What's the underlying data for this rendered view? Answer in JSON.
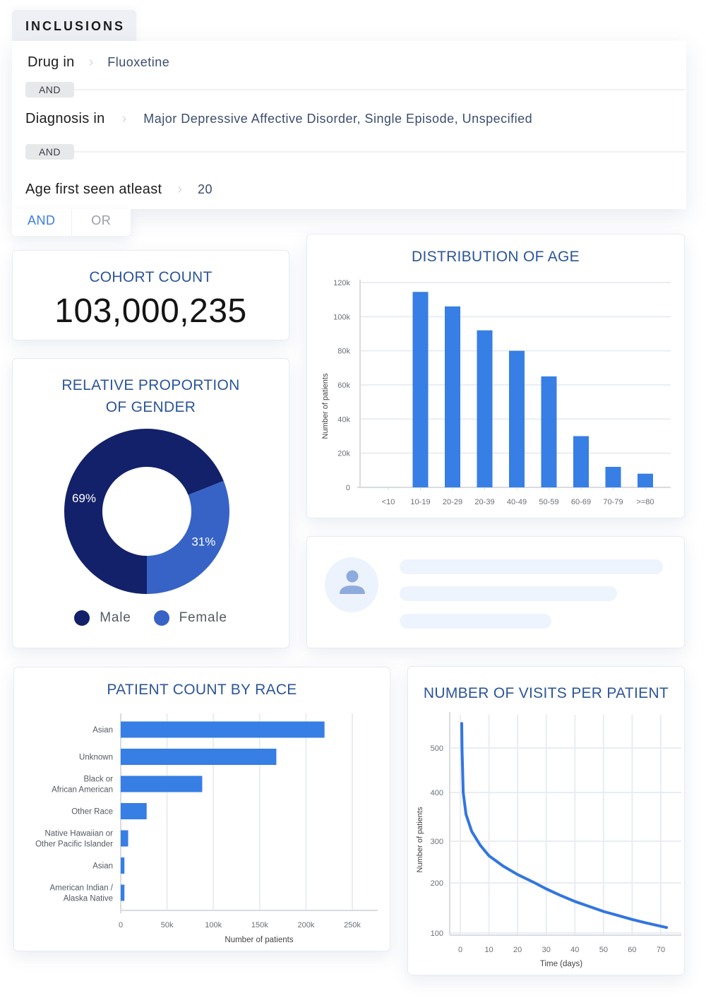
{
  "inclusions": {
    "tab_label": "INCLUSIONS",
    "rules": [
      {
        "label": "Drug in",
        "chevron_icon": "chevron-right-icon",
        "value": "Fluoxetine"
      },
      {
        "label": "Diagnosis in",
        "chevron_icon": "chevron-right-icon",
        "value": "Major Depressive Affective Disorder, Single Episode, Unspecified"
      },
      {
        "label": "Age first seen atleast",
        "chevron_icon": "chevron-right-icon",
        "value": "20"
      }
    ],
    "separators": [
      "AND",
      "AND"
    ],
    "logic_toggle": {
      "options": [
        "AND",
        "OR"
      ],
      "selected": "AND"
    }
  },
  "cohort": {
    "title": "COHORT COUNT",
    "value": "103,000,235"
  },
  "gender": {
    "title_line1": "RELATIVE PROPORTION",
    "title_line2": "OF GENDER"
  },
  "placeholder_card": {
    "avatar_icon": "user-icon",
    "skeleton_lines": 3
  },
  "colors": {
    "title_blue": "#2c5597",
    "bar_blue": "#377ee5",
    "male_navy": "#13216a",
    "female_blue": "#3663c5",
    "and_active": "#3b7ddd"
  },
  "chart_data": [
    {
      "id": "age",
      "type": "bar",
      "title": "DISTRIBUTION OF AGE",
      "xlabel": "",
      "ylabel": "Number of patients",
      "categories": [
        "<10",
        "10-19",
        "20-29",
        "20-39",
        "40-49",
        "50-59",
        "60-69",
        "70-79",
        ">=80"
      ],
      "values": [
        0,
        114500,
        106000,
        92000,
        80000,
        65000,
        30000,
        12000,
        8000
      ],
      "yticks": [
        0,
        20000,
        40000,
        60000,
        80000,
        100000,
        120000
      ],
      "ytick_labels": [
        "0",
        "20k",
        "40k",
        "60k",
        "80k",
        "100k",
        "120k"
      ],
      "ylim": [
        0,
        120000
      ],
      "grid": true
    },
    {
      "id": "gender",
      "type": "pie",
      "title": "RELATIVE PROPORTION OF GENDER",
      "labels": [
        "Male",
        "Female"
      ],
      "values": [
        69,
        31
      ],
      "value_labels": [
        "69%",
        "31%"
      ],
      "donut": true,
      "legend": "bottom"
    },
    {
      "id": "race",
      "type": "bar",
      "orientation": "horizontal",
      "title": "PATIENT COUNT BY RACE",
      "xlabel": "Number of patients",
      "ylabel": "",
      "categories": [
        "Asian",
        "Unknown",
        "Black or\nAfrican American",
        "Other Race",
        "Native Hawaiian or\nOther Pacific Islander",
        "Asian",
        "American Indian /\nAlaska Native"
      ],
      "values": [
        220000,
        168000,
        88000,
        28000,
        8000,
        4000,
        4000
      ],
      "xticks": [
        0,
        50000,
        100000,
        150000,
        200000,
        250000
      ],
      "xtick_labels": [
        "0",
        "50k",
        "100k",
        "150k",
        "200k",
        "250k"
      ],
      "xlim": [
        0,
        275000
      ],
      "grid": true
    },
    {
      "id": "visits",
      "type": "line",
      "title": "NUMBER OF VISITS PER PATIENT",
      "xlabel": "Time (days)",
      "ylabel": "Number of patients",
      "x": [
        0.5,
        0.6,
        1,
        2,
        4,
        7,
        10,
        15,
        20,
        26,
        30,
        35,
        40,
        45,
        50,
        55,
        60,
        65,
        72
      ],
      "y": [
        555,
        500,
        400,
        355,
        320,
        290,
        265,
        240,
        220,
        200,
        188,
        175,
        163,
        153,
        143,
        135,
        127,
        120,
        111
      ],
      "xticks": [
        0,
        10,
        20,
        30,
        40,
        50,
        60,
        70
      ],
      "yticks": [
        100,
        200,
        300,
        400,
        500
      ],
      "xlim": [
        -5,
        74
      ],
      "ylim": [
        95,
        580
      ],
      "grid": true
    }
  ]
}
